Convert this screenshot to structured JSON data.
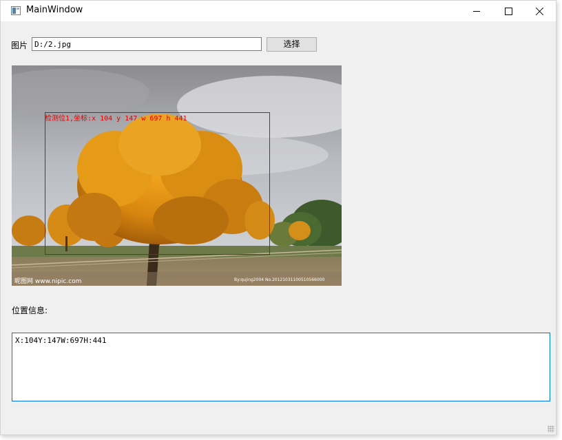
{
  "window": {
    "title": "MainWindow"
  },
  "form": {
    "image_label": "图片",
    "image_path": "D:/2.jpg",
    "choose_button": "选择",
    "position_label": "位置信息:"
  },
  "detection": {
    "overlay_text": "检测位1,坐标:x 104 y 147 w 697 h 441",
    "box_color": "#e00000"
  },
  "photo": {
    "watermark_left": "昵图网 www.nipic.com",
    "watermark_right": "By:qujing2004 No.20121031100510566000"
  },
  "output": {
    "text": "X:104Y:147W:697H:441"
  },
  "colors": {
    "focus_border": "#0078d7",
    "window_bg": "#f0f0f0"
  }
}
